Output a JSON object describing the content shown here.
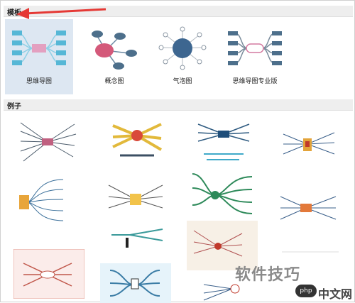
{
  "sections": {
    "templates_title": "模板",
    "examples_title": "例子"
  },
  "templates": [
    {
      "label": "思维导图",
      "icon": "mind-map-icon",
      "selected": true
    },
    {
      "label": "概念图",
      "icon": "concept-map-icon",
      "selected": false
    },
    {
      "label": "气泡图",
      "icon": "bubble-map-icon",
      "selected": false
    },
    {
      "label": "思维导图专业版",
      "icon": "mind-map-pro-icon",
      "selected": false
    }
  ],
  "examples": {
    "count": 15
  },
  "watermark": {
    "text": "软件技巧",
    "logo_mark": "php",
    "logo_text": "中文网"
  },
  "colors": {
    "selected_bg": "#dde7f2",
    "header_bg": "#eeeeee",
    "arrow": "#e53935",
    "mindmap_center": "#e3a0c0",
    "mindmap_node": "#56b7d6",
    "concept_center": "#d4597a",
    "concept_node": "#4d6f8b",
    "bubble_center": "#3d6690",
    "pro_node": "#4d6f8b"
  }
}
